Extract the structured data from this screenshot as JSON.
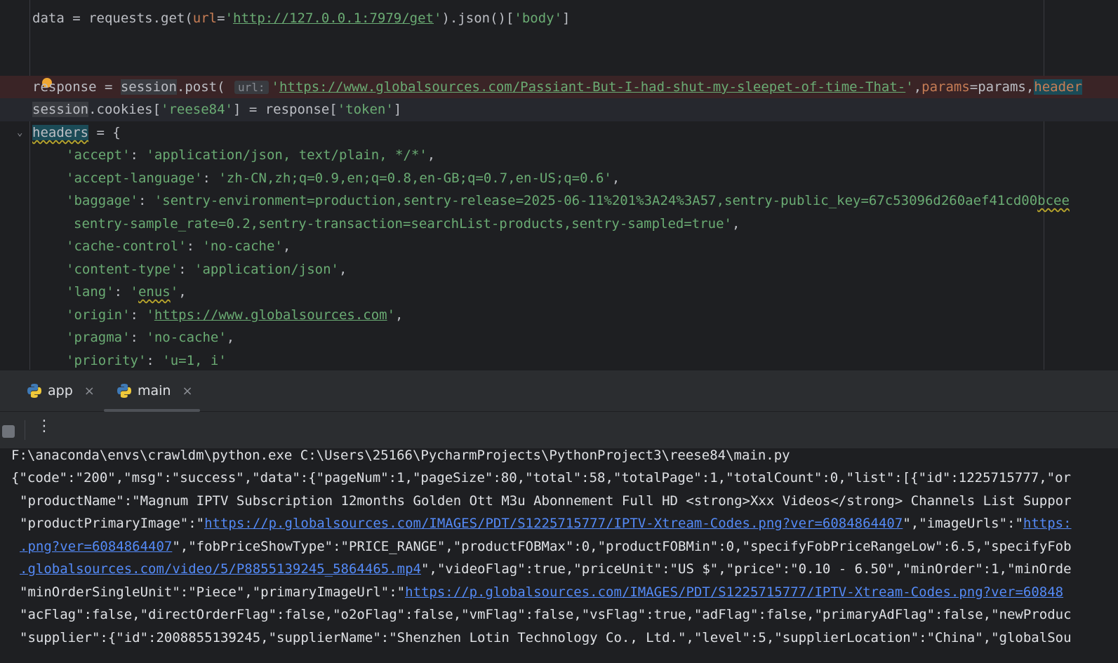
{
  "editor": {
    "lines": {
      "l1": {
        "a": "data = requests.get(",
        "kw": "url",
        "b": "=",
        "s1": "'",
        "url": "http://127.0.0.1:7979/get",
        "s2": "'",
        "c": ").json()[",
        "s3": "'body'",
        "d": "]"
      },
      "l2": {
        "a": "re",
        "b": "sponse = ",
        "session": "session",
        "c": ".post( ",
        "inlay": "url:",
        "q": "'",
        "url": "https://www.globalsources.com/Passiant-But-I-had-shut-my-sleepet-of-time-That-",
        "q2": "'",
        "comma": ",",
        "kw": "params",
        "e": "=params,",
        "kw2": "header"
      },
      "l3": {
        "a": "session",
        "b": ".cookies[",
        "s1": "'reese84'",
        "c": "] = response[",
        "s2": "'token'",
        "d": "]"
      },
      "l4": {
        "var": "headers",
        "rest": " = {"
      },
      "l5": {
        "k": "'accept'",
        "m": ": ",
        "v": "'application/json, text/plain, */*'",
        "e": ","
      },
      "l6": {
        "k": "'accept-language'",
        "m": ": ",
        "v": "'zh-CN,zh;q=0.9,en;q=0.8,en-GB;q=0.7,en-US;q=0.6'",
        "e": ","
      },
      "l7": {
        "k": "'baggage'",
        "m": ": ",
        "v": "'sentry-environment=production,sentry-release=2025-06-11%201%3A24%3A57,sentry-public_key=67c53096d260aef41cd00",
        "sq": "bcee"
      },
      "l8": {
        "v": "sentry-sample_rate=0.2,sentry-transaction=searchList-products,sentry-sampled=true'",
        "e": ","
      },
      "l9": {
        "k": "'cache-control'",
        "m": ": ",
        "v": "'no-cache'",
        "e": ","
      },
      "l10": {
        "k": "'content-type'",
        "m": ": ",
        "v": "'application/json'",
        "e": ","
      },
      "l11": {
        "k": "'lang'",
        "m": ": ",
        "q": "'",
        "v": "enus",
        "q2": "'",
        "e": ","
      },
      "l12": {
        "k": "'origin'",
        "m": ": ",
        "q": "'",
        "v": "https://www.globalsources.com",
        "q2": "'",
        "e": ","
      },
      "l13": {
        "k": "'pragma'",
        "m": ": ",
        "v": "'no-cache'",
        "e": ","
      },
      "l14": {
        "k": "'priority'",
        "m": ": ",
        "v": "'u=1, i'"
      }
    }
  },
  "tabs": [
    {
      "label": "app",
      "close": "×"
    },
    {
      "label": "main",
      "close": "×"
    }
  ],
  "toolbar": {
    "more": "⋮"
  },
  "console": {
    "cmd": "F:\\anaconda\\envs\\crawldm\\python.exe C:\\Users\\25166\\PycharmProjects\\PythonProject3\\reese84\\main.py",
    "l1": "{\"code\":\"200\",\"msg\":\"success\",\"data\":{\"pageNum\":1,\"pageSize\":80,\"total\":58,\"totalPage\":1,\"totalCount\":0,\"list\":[{\"id\":1225715777,\"or",
    "l2": "\"productName\":\"Magnum IPTV Subscription 12months Golden Ott M3u Abonnement Full HD <strong>Xxx Videos</strong> Channels List Suppor",
    "l3a": "\"productPrimaryImage\":\"",
    "l3link": "https://p.globalsources.com/IMAGES/PDT/S1225715777/IPTV-Xtream-Codes.png?ver=6084864407",
    "l3b": "\",\"imageUrls\":\"",
    "l3link2": "https:",
    "l4link": ".png?ver=6084864407",
    "l4b": "\",\"fobPriceShowType\":\"PRICE_RANGE\",\"productFOBMax\":0,\"productFOBMin\":0,\"specifyFobPriceRangeLow\":6.5,\"specifyFob",
    "l5link": ".globalsources.com/video/5/P8855139245_5864465.mp4",
    "l5b": "\",\"videoFlag\":true,\"priceUnit\":\"US $\",\"price\":\"0.10 - 6.50\",\"minOrder\":1,\"minOrde",
    "l6a": "\"minOrderSingleUnit\":\"Piece\",\"primaryImageUrl\":\"",
    "l6link": "https://p.globalsources.com/IMAGES/PDT/S1225715777/IPTV-Xtream-Codes.png?ver=60848",
    "l7": "\"acFlag\":false,\"directOrderFlag\":false,\"o2oFlag\":false,\"vmFlag\":false,\"vsFlag\":true,\"adFlag\":false,\"primaryAdFlag\":false,\"newProduc",
    "l8": "\"supplier\":{\"id\":2008855139245,\"supplierName\":\"Shenzhen Lotin Technology Co., Ltd.\",\"level\":5,\"supplierLocation\":\"China\",\"globalSou"
  }
}
